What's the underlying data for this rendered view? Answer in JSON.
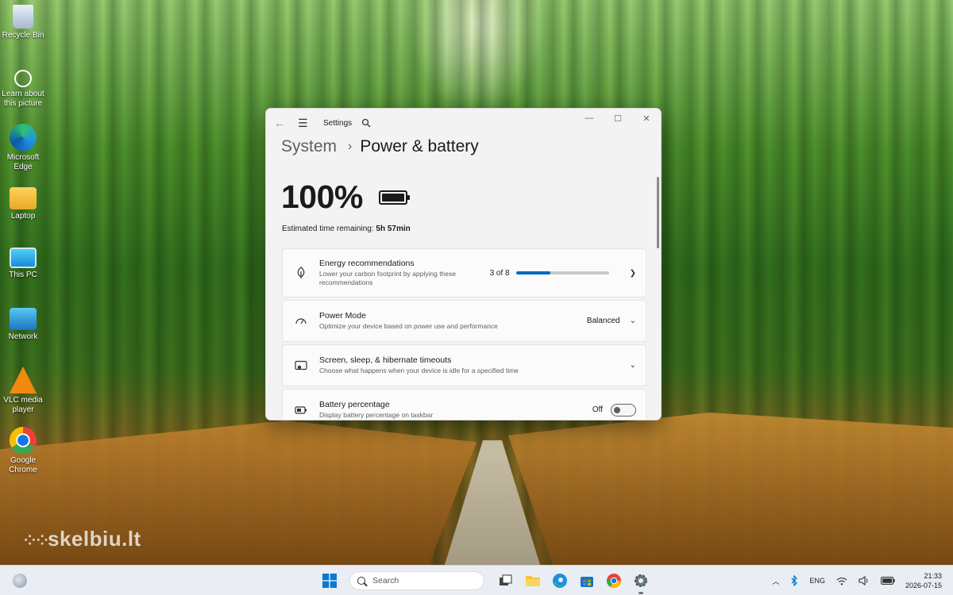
{
  "watermark": "skelbiu.lt",
  "desktop": {
    "icons": [
      {
        "label": "Recycle Bin",
        "icon": "recycle-bin-icon"
      },
      {
        "label": "Learn about this picture",
        "icon": "learn-about-icon"
      },
      {
        "label": "Microsoft Edge",
        "icon": "edge-icon"
      },
      {
        "label": "Laptop",
        "icon": "user-folder-icon"
      },
      {
        "label": "This PC",
        "icon": "monitor-icon"
      },
      {
        "label": "Network",
        "icon": "network-icon"
      },
      {
        "label": "VLC media player",
        "icon": "vlc-icon"
      },
      {
        "label": "Google Chrome",
        "icon": "chrome-icon"
      }
    ]
  },
  "settings": {
    "app_title": "Settings",
    "breadcrumb": {
      "parent": "System",
      "separator": "›",
      "current": "Power & battery"
    },
    "battery_percent": "100%",
    "estimate": {
      "label": "Estimated time remaining:",
      "value": "5h 57min"
    },
    "cards": [
      {
        "title": "Energy recommendations",
        "subtitle": "Lower your carbon footprint by applying these recommendations",
        "value": "3 of 8",
        "progress": 0.375,
        "icon": "leaf-icon"
      },
      {
        "title": "Power Mode",
        "subtitle": "Optimize your device based on power use and performance",
        "value": "Balanced",
        "icon": "power-mode-icon"
      },
      {
        "title": "Screen, sleep, & hibernate timeouts",
        "subtitle": "Choose what happens when your device is idle for a specified time",
        "value": "",
        "icon": "screen-sleep-icon"
      },
      {
        "title": "Battery percentage",
        "subtitle": "Display battery percentage on taskbar",
        "value": "Off",
        "toggle_on": false,
        "icon": "battery-saver-icon"
      }
    ]
  },
  "taskbar": {
    "search_placeholder": "Search",
    "language": "ENG",
    "time": "21:33",
    "date": "2026-07-15"
  },
  "colors": {
    "accent": "#0067c0",
    "window_bg": "#f3f3f3",
    "taskbar_bg": "#eaeef4"
  }
}
